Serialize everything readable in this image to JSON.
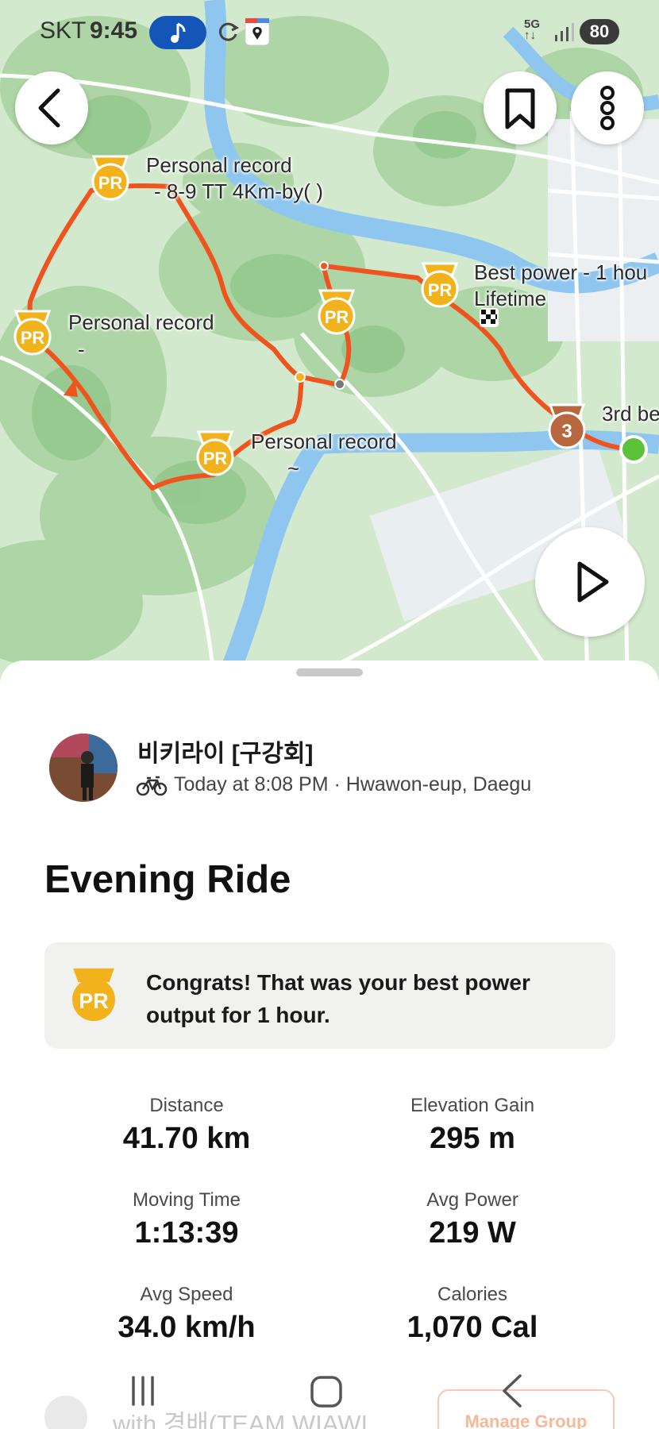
{
  "status_bar": {
    "carrier": "SKT",
    "time": "9:45",
    "network": "5G",
    "battery": "80"
  },
  "map": {
    "labels": {
      "pr_top_line1": "Personal record",
      "pr_top_line2": "- 8-9  TT 4Km-by(    )",
      "pr_left_line1": "Personal record",
      "pr_left_line2": "-",
      "pr_bottom_line1": "Personal record",
      "pr_bottom_line2": "~",
      "best_power_line1": "Best power - 1 hou",
      "best_power_line2": "Lifetime",
      "third_best": "3rd be"
    },
    "pr_badge_text": "PR",
    "medal_rank": "3",
    "route_color": "#f0541e"
  },
  "activity": {
    "athlete_name": "비키라이 [구강회]",
    "meta": "Today at 8:08 PM · Hwawon-eup, Daegu",
    "title": "Evening Ride",
    "congrats": "Congrats! That was your best power output for 1 hour.",
    "stats": [
      {
        "label": "Distance",
        "value": "41.70 km"
      },
      {
        "label": "Elevation Gain",
        "value": "295 m"
      },
      {
        "label": "Moving Time",
        "value": "1:13:39"
      },
      {
        "label": "Avg Power",
        "value": "219 W"
      },
      {
        "label": "Avg Speed",
        "value": "34.0 km/h"
      },
      {
        "label": "Calories",
        "value": "1,070 Cal"
      }
    ]
  },
  "group": {
    "text": "with 경배(TEAM WIAWI...",
    "manage_label": "Manage Group"
  },
  "icons": {
    "back": "chevron-left-icon",
    "bookmark": "bookmark-icon",
    "more": "more-vertical-icon",
    "play": "play-icon",
    "bike": "bicycle-icon",
    "pr": "pr-medal-icon"
  },
  "colors": {
    "accent": "#f0541e",
    "pr_gold": "#f2b21c",
    "map_land": "#cfe6c9",
    "map_water": "#8ec6ef",
    "manage_button": "#f6b898"
  }
}
